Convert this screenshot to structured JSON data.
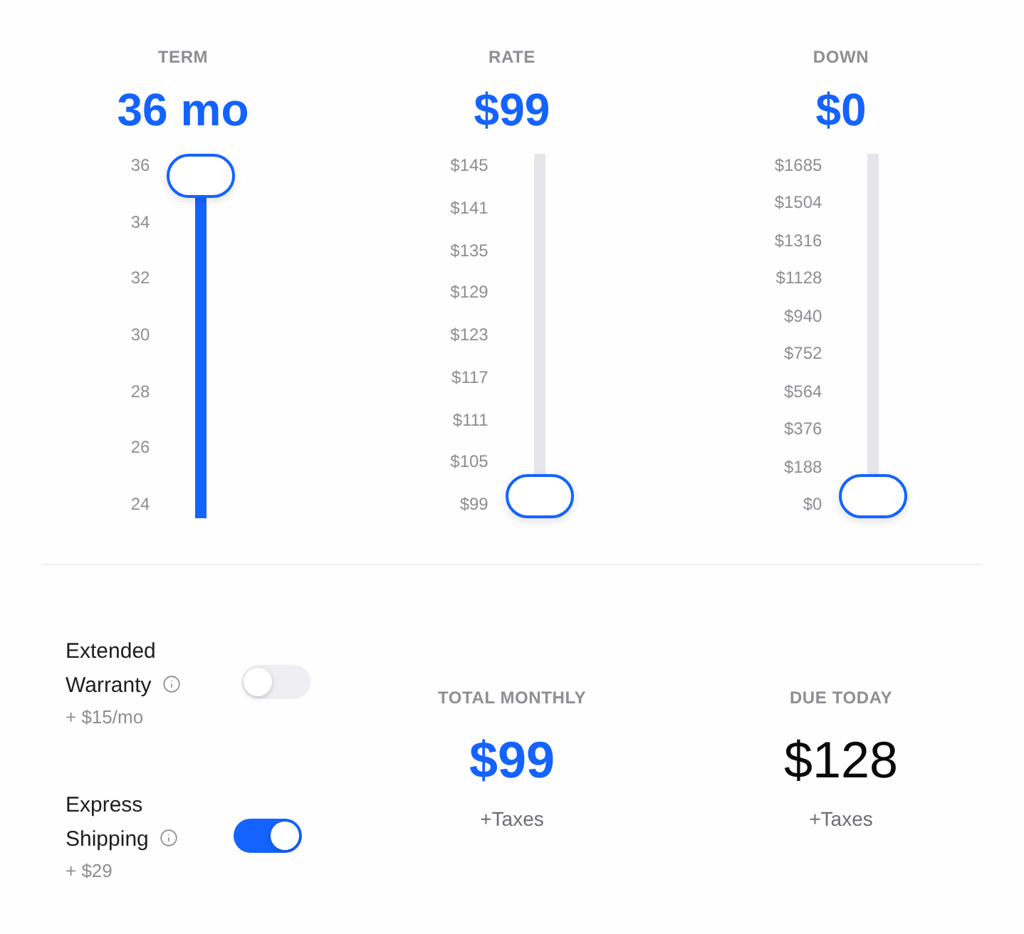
{
  "sliders": [
    {
      "label": "TERM",
      "value": "36 mo",
      "level": 1,
      "ticks": [
        "36",
        "34",
        "32",
        "30",
        "28",
        "26",
        "24"
      ]
    },
    {
      "label": "RATE",
      "value": "$99",
      "level": 0,
      "ticks": [
        "$145",
        "$141",
        "$135",
        "$129",
        "$123",
        "$117",
        "$111",
        "$105",
        "$99"
      ]
    },
    {
      "label": "DOWN",
      "value": "$0",
      "level": 0,
      "ticks": [
        "$1685",
        "$1504",
        "$1316",
        "$1128",
        "$940",
        "$752",
        "$564",
        "$376",
        "$188",
        "$0"
      ]
    }
  ],
  "options": [
    {
      "title": "Extended Warranty",
      "price": "+ $15/mo",
      "on": false
    },
    {
      "title": "Express Shipping",
      "price": "+ $29",
      "on": true
    }
  ],
  "summary": [
    {
      "label": "TOTAL MONTHLY",
      "amount": "$99",
      "note": "+Taxes",
      "kind": "accent"
    },
    {
      "label": "DUE TODAY",
      "amount": "$128",
      "note": "+Taxes",
      "kind": "plain"
    }
  ]
}
